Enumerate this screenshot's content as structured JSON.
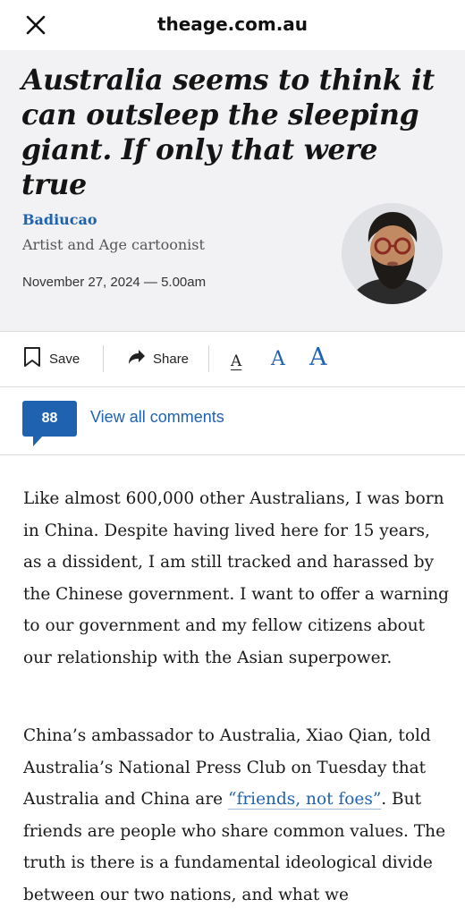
{
  "topbar": {
    "close_icon": "close-icon",
    "domain": "theage.com.au"
  },
  "article": {
    "headline": "Australia seems to think it can outsleep the sleeping giant. If only that were true",
    "author_name": "Badiucao",
    "author_role": "Artist and Age cartoonist",
    "date": "November 27, 2024 — 5.00am",
    "avatar_icon": "author-photo"
  },
  "toolbar": {
    "save_label": "Save",
    "save_icon": "bookmark-icon",
    "share_label": "Share",
    "share_icon": "share-arrow-icon",
    "font_small": "A",
    "font_medium": "A",
    "font_large": "A"
  },
  "comments": {
    "count": "88",
    "link_label": "View all comments"
  },
  "paragraphs": {
    "p1": "Like almost 600,000 other Australians, I was born in China. Despite having lived here for 15 years, as a dissident, I am still tracked and harassed by the Chinese government. I want to offer a warning to our government and my fellow citizens about our relationship with the Asian superpower.",
    "p2_before": "China’s ambassador to Australia, Xiao Qian, told Australia’s National Press Club on Tuesday that Australia and China are ",
    "p2_link": "“friends, not foes”",
    "p2_after": ". But friends are people who share common values. The truth is there is a fundamental ideological divide between our two nations, and what we"
  },
  "colors": {
    "accent": "#1f62b0",
    "header_bg": "#f2f2f4"
  }
}
